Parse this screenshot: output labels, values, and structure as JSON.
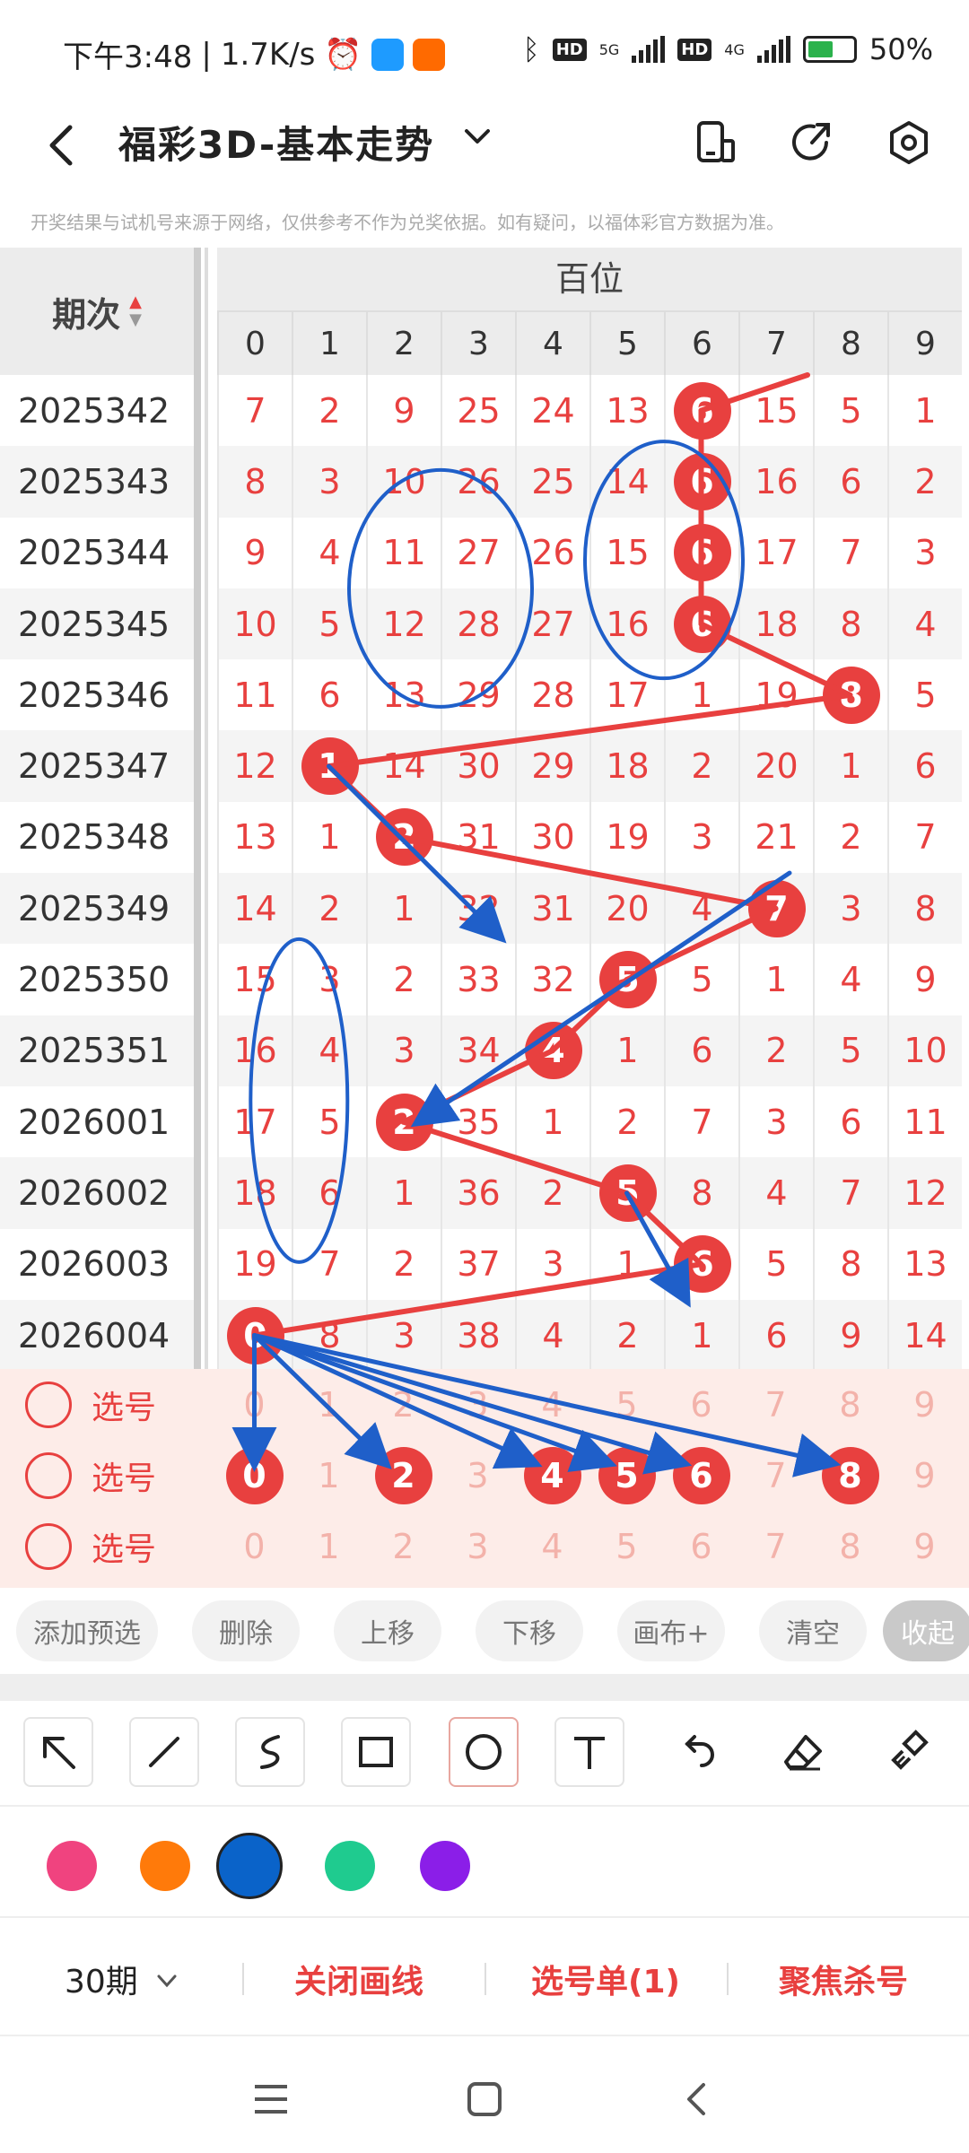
{
  "status": {
    "time": "下午3:48",
    "speed": "1.7K/s",
    "net5g": "5G",
    "net4g": "4G",
    "battery": "50%"
  },
  "header": {
    "title": "福彩3D-基本走势",
    "notice": "开奖结果与试机号来源于网络，仅供参考不作为兑奖依据。如有疑问，以福体彩官方数据为准。"
  },
  "table": {
    "period_header": "期次",
    "section_title": "百位",
    "digits": [
      "0",
      "1",
      "2",
      "3",
      "4",
      "5",
      "6",
      "7",
      "8",
      "9"
    ],
    "rows": [
      {
        "period": "2025342",
        "cells": [
          "7",
          "2",
          "9",
          "25",
          "24",
          "13",
          "6",
          "15",
          "5",
          "1"
        ],
        "hit": 6
      },
      {
        "period": "2025343",
        "cells": [
          "8",
          "3",
          "10",
          "26",
          "25",
          "14",
          "6",
          "16",
          "6",
          "2"
        ],
        "hit": 6
      },
      {
        "period": "2025344",
        "cells": [
          "9",
          "4",
          "11",
          "27",
          "26",
          "15",
          "6",
          "17",
          "7",
          "3"
        ],
        "hit": 6
      },
      {
        "period": "2025345",
        "cells": [
          "10",
          "5",
          "12",
          "28",
          "27",
          "16",
          "6",
          "18",
          "8",
          "4"
        ],
        "hit": 6
      },
      {
        "period": "2025346",
        "cells": [
          "11",
          "6",
          "13",
          "29",
          "28",
          "17",
          "1",
          "19",
          "8",
          "5"
        ],
        "hit": 8
      },
      {
        "period": "2025347",
        "cells": [
          "12",
          "1",
          "14",
          "30",
          "29",
          "18",
          "2",
          "20",
          "1",
          "6"
        ],
        "hit": 1
      },
      {
        "period": "2025348",
        "cells": [
          "13",
          "1",
          "2",
          "31",
          "30",
          "19",
          "3",
          "21",
          "2",
          "7"
        ],
        "hit": 2
      },
      {
        "period": "2025349",
        "cells": [
          "14",
          "2",
          "1",
          "32",
          "31",
          "20",
          "4",
          "7",
          "3",
          "8"
        ],
        "hit": 7
      },
      {
        "period": "2025350",
        "cells": [
          "15",
          "3",
          "2",
          "33",
          "32",
          "5",
          "5",
          "1",
          "4",
          "9"
        ],
        "hit": 5
      },
      {
        "period": "2025351",
        "cells": [
          "16",
          "4",
          "3",
          "34",
          "4",
          "1",
          "6",
          "2",
          "5",
          "10"
        ],
        "hit": 4
      },
      {
        "period": "2026001",
        "cells": [
          "17",
          "5",
          "2",
          "35",
          "1",
          "2",
          "7",
          "3",
          "6",
          "11"
        ],
        "hit": 2
      },
      {
        "period": "2026002",
        "cells": [
          "18",
          "6",
          "1",
          "36",
          "2",
          "5",
          "8",
          "4",
          "7",
          "12"
        ],
        "hit": 5
      },
      {
        "period": "2026003",
        "cells": [
          "19",
          "7",
          "2",
          "37",
          "3",
          "1",
          "6",
          "5",
          "8",
          "13"
        ],
        "hit": 6
      },
      {
        "period": "2026004",
        "cells": [
          "0",
          "8",
          "3",
          "38",
          "4",
          "2",
          "1",
          "6",
          "9",
          "14"
        ],
        "hit": 0
      }
    ],
    "pick_label": "选号",
    "pick_rows": [
      {
        "selected": []
      },
      {
        "selected": [
          0,
          2,
          4,
          5,
          6,
          8
        ]
      },
      {
        "selected": []
      }
    ]
  },
  "actions": {
    "add": "添加预选",
    "delete": "删除",
    "up": "上移",
    "down": "下移",
    "canvas": "画布+",
    "clear": "清空",
    "collapse": "收起"
  },
  "palette": {
    "colors": [
      "#f0437f",
      "#ff7a0a",
      "#0a63c9",
      "#1fcb8f",
      "#8b1ee8"
    ],
    "selected": "#0a63c9",
    "ball_red": "#e8403f",
    "draw_blue": "#1f5fc9"
  },
  "bottom": {
    "periods": "30期",
    "close_lines": "关闭画线",
    "pick_list": "选号单(1)",
    "focus_kill": "聚焦杀号"
  },
  "icons": {
    "back": "back-arrow-icon",
    "dropdown": "chevron-down-icon",
    "mode": "layout-icon",
    "share": "share-icon",
    "settings": "hexagon-settings-icon"
  }
}
